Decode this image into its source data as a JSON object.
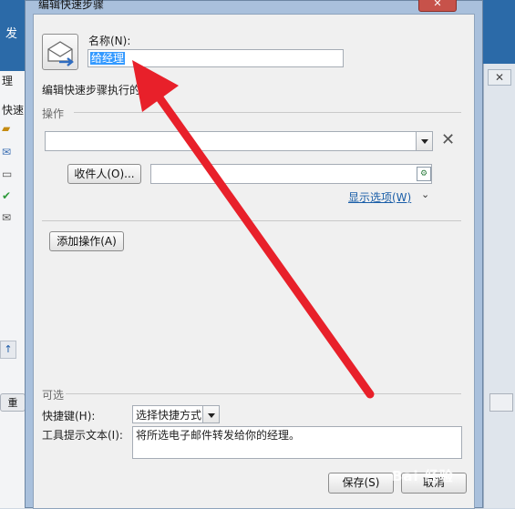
{
  "background": {
    "app_text": "发",
    "left_items": [
      "理",
      "快速"
    ],
    "close_label": "✕",
    "scroll_glyph": "↑",
    "bottom_button": "重"
  },
  "dialog": {
    "title": "编辑快速步骤",
    "close_label": "✕",
    "name_label": "名称(N):",
    "name_value": "给经理",
    "steps_label": "编辑快速步骤执行的",
    "actions_section": "操作",
    "action_combo_value": "",
    "recipient_button": "收件人(O)...",
    "recipient_value": "",
    "show_options_link": "显示选项(W)",
    "add_action_button": "添加操作(A)",
    "optional_section": "可选",
    "shortcut_label": "快捷键(H):",
    "shortcut_value": "选择快捷方式",
    "tooltip_label": "工具提示文本(I):",
    "tooltip_value": "将所选电子邮件转发给你的经理。",
    "save_button": "保存(S)",
    "cancel_button": "取消"
  },
  "annotation": {
    "arrow_color": "#e8202a"
  },
  "watermark": "Bai 经验"
}
